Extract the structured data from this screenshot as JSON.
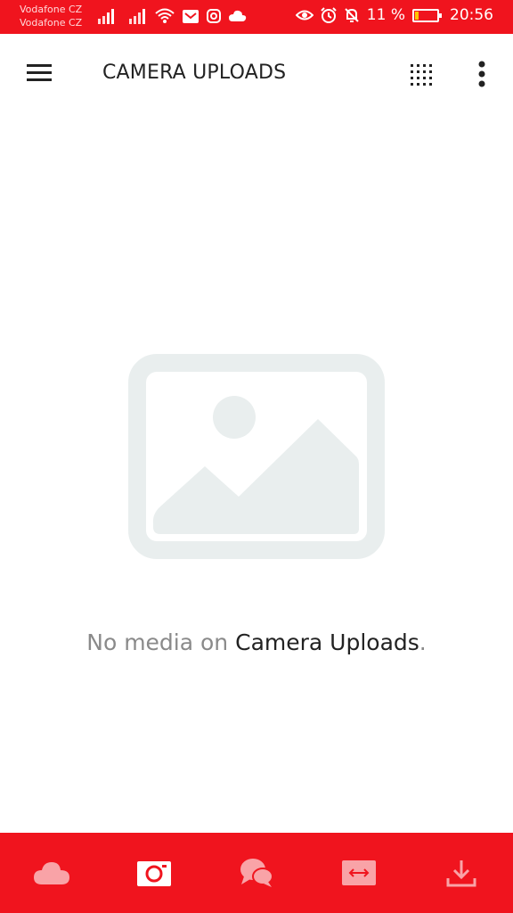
{
  "status_bar": {
    "carrier_1": "Vodafone CZ",
    "carrier_2": "Vodafone CZ",
    "battery_percent": "11 %",
    "battery_level": 0.11,
    "time": "20:56"
  },
  "app_bar": {
    "title": "CAMERA UPLOADS"
  },
  "empty_state": {
    "message_prefix": "No media on ",
    "message_highlight": "Camera Uploads",
    "message_suffix": "."
  },
  "bottom_nav": {
    "items": [
      {
        "icon": "cloud-drive-icon",
        "active": false
      },
      {
        "icon": "camera-uploads-icon",
        "active": true
      },
      {
        "icon": "chat-icon",
        "active": false
      },
      {
        "icon": "transfers-icon",
        "active": false
      },
      {
        "icon": "offline-download-icon",
        "active": false
      }
    ]
  },
  "colors": {
    "brand_red": "#f0141e",
    "placeholder_gray": "#e9eeee",
    "inactive_icon": "#f9a3a7"
  }
}
